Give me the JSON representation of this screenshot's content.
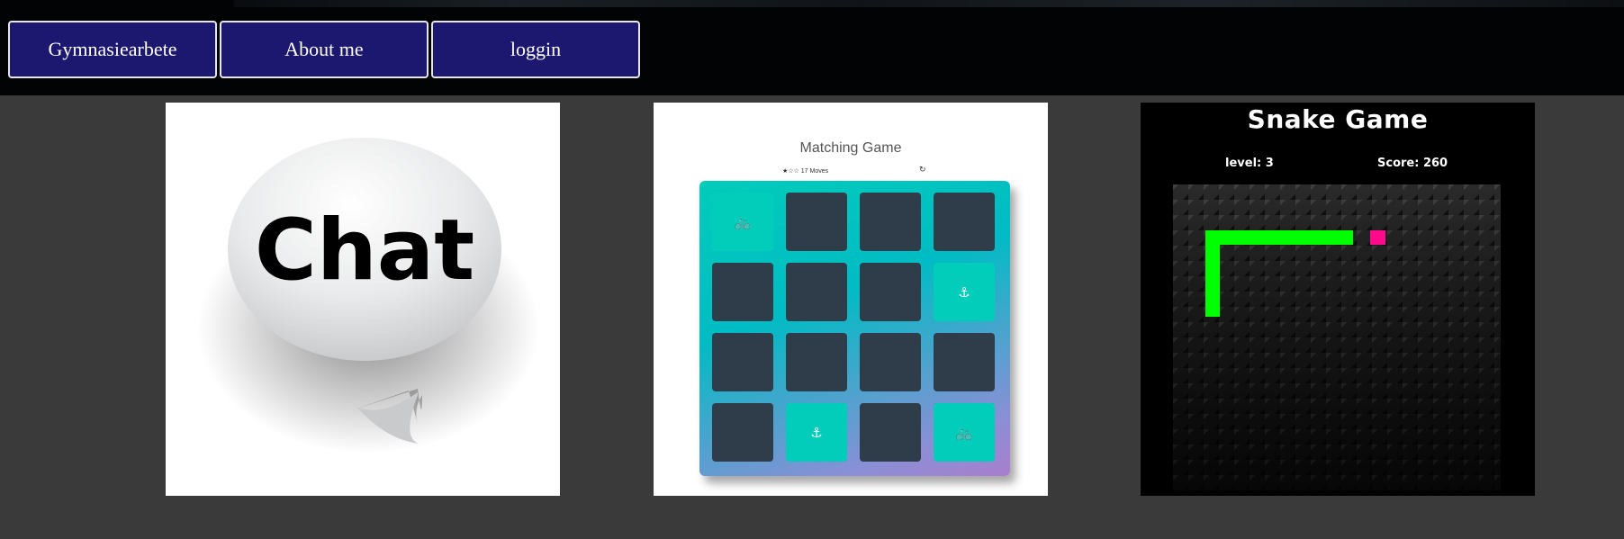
{
  "nav": {
    "items": [
      {
        "label": "Gymnasiearbete"
      },
      {
        "label": "About me"
      },
      {
        "label": "loggin"
      }
    ]
  },
  "cards": {
    "chat": {
      "bubble_text": "Chat",
      "icon": "chat-bubble-icon"
    },
    "matching": {
      "title": "Matching Game",
      "stars": "★☆☆",
      "moves": "17 Moves",
      "restart_icon": "restart-icon",
      "grid": [
        [
          "🚲",
          "",
          "",
          ""
        ],
        [
          "",
          "",
          "",
          "⚓"
        ],
        [
          "",
          "",
          "",
          ""
        ],
        [
          "",
          "⚓",
          "",
          "🚲"
        ]
      ]
    },
    "snake": {
      "title": "Snake Game",
      "level": "level: 3",
      "score": "Score: 260",
      "colors": {
        "snake": "#00ff00",
        "food": "#ff0a8a"
      }
    }
  }
}
